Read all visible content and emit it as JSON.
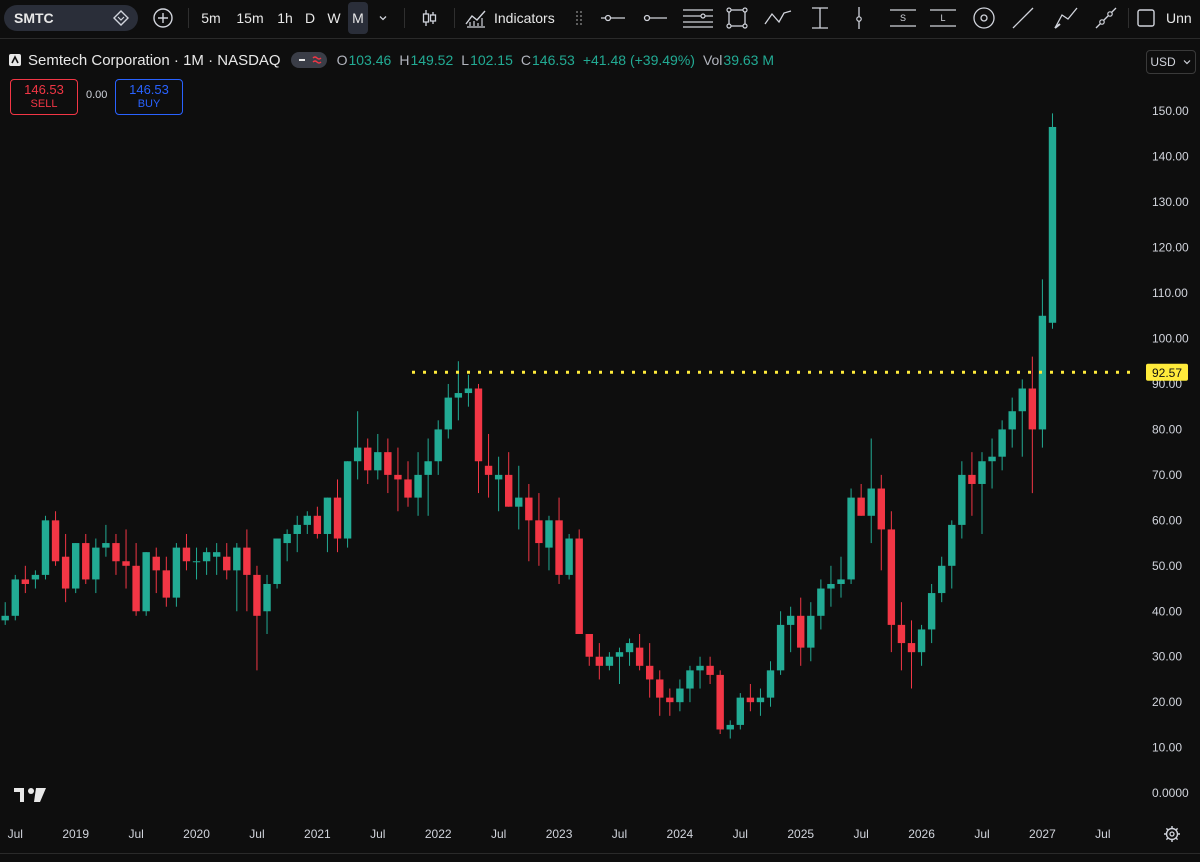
{
  "toolbar": {
    "symbol": "SMTC",
    "timeframes": [
      "5m",
      "15m",
      "1h",
      "D",
      "W",
      "M"
    ],
    "active_timeframe": "M",
    "indicators_label": "Indicators",
    "overflow_label": "Unn"
  },
  "legend": {
    "title": "Semtech Corporation · 1M · NASDAQ",
    "open_label": "O",
    "open": "103.46",
    "high_label": "H",
    "high": "149.52",
    "low_label": "L",
    "low": "102.15",
    "close_label": "C",
    "close": "146.53",
    "change": "+41.48 (+39.49%)",
    "vol_label": "Vol",
    "vol": "39.63 M"
  },
  "trade": {
    "sell_price": "146.53",
    "sell_label": "SELL",
    "spread": "0.00",
    "buy_price": "146.53",
    "buy_label": "BUY"
  },
  "currency": "USD",
  "colors": {
    "up": "#22ab94",
    "down": "#f23645",
    "level_line": "#ffeb3b",
    "background": "#0e0e0e"
  },
  "icons": [
    "alert-diamond-icon",
    "add-compare-icon",
    "chevron-down-icon",
    "candles-icon",
    "indicators-icon",
    "drag-handle-icon",
    "horizontal-ray-icon",
    "horizontal-line-icon",
    "parallel-lines-icon",
    "rectangle-icon",
    "path-icon",
    "vertical-range-icon",
    "vertical-line-icon",
    "s-lines-icon",
    "l-lines-icon",
    "circle-icon",
    "trend-line-icon",
    "brush-icon",
    "trend-segment-icon",
    "layout-icon",
    "tradingview-logo-icon",
    "settings-gear-icon"
  ],
  "chart_data": {
    "type": "candlestick",
    "title": "Semtech Corporation · 1M · NASDAQ",
    "ylim": [
      0,
      155
    ],
    "y_ticks": [
      "150.00",
      "140.00",
      "130.00",
      "120.00",
      "110.00",
      "100.00",
      "90.00",
      "80.00",
      "70.00",
      "60.00",
      "50.00",
      "40.00",
      "30.00",
      "20.00",
      "10.00",
      "0.0000"
    ],
    "x_ticks": [
      "Jul",
      "2019",
      "Jul",
      "2020",
      "Jul",
      "2021",
      "Jul",
      "2022",
      "Jul",
      "2023",
      "Jul",
      "2024",
      "Jul",
      "2025",
      "Jul",
      "2026",
      "Jul",
      "2027",
      "Jul"
    ],
    "horizontal_level": {
      "value": 92.57,
      "label": "92.57",
      "style": "dotted"
    },
    "start": "2018-06",
    "ohlc": [
      [
        38,
        42,
        37,
        39
      ],
      [
        39,
        48,
        38,
        47
      ],
      [
        47,
        50,
        44,
        46
      ],
      [
        47,
        49,
        45,
        48
      ],
      [
        48,
        61,
        47,
        60
      ],
      [
        60,
        62,
        50,
        51
      ],
      [
        52,
        57,
        42,
        45
      ],
      [
        45,
        55,
        44,
        55
      ],
      [
        55,
        57,
        46,
        47
      ],
      [
        47,
        56,
        44,
        54
      ],
      [
        54,
        59,
        52,
        55
      ],
      [
        55,
        57,
        48,
        51
      ],
      [
        51,
        58,
        45,
        50
      ],
      [
        50,
        55,
        39,
        40
      ],
      [
        40,
        53,
        39,
        53
      ],
      [
        52,
        54,
        44,
        49
      ],
      [
        49,
        52,
        41,
        43
      ],
      [
        43,
        55,
        41,
        54
      ],
      [
        54,
        57,
        49,
        51
      ],
      [
        51,
        54,
        47,
        51
      ],
      [
        51,
        54,
        48,
        53
      ],
      [
        52,
        55,
        48,
        53
      ],
      [
        52,
        55,
        47,
        49
      ],
      [
        49,
        55,
        40,
        54
      ],
      [
        54,
        58,
        40,
        48
      ],
      [
        48,
        50,
        27,
        39
      ],
      [
        40,
        48,
        35,
        46
      ],
      [
        46,
        56,
        45,
        56
      ],
      [
        55,
        58,
        51,
        57
      ],
      [
        57,
        61,
        53,
        59
      ],
      [
        59,
        62,
        57,
        61
      ],
      [
        61,
        63,
        56,
        57
      ],
      [
        57,
        65,
        53,
        65
      ],
      [
        65,
        69,
        53,
        56
      ],
      [
        56,
        73,
        54,
        73
      ],
      [
        73,
        84,
        69,
        76
      ],
      [
        76,
        78,
        68,
        71
      ],
      [
        71,
        79,
        69,
        75
      ],
      [
        75,
        78,
        66,
        70
      ],
      [
        70,
        76,
        62,
        69
      ],
      [
        69,
        73,
        63,
        65
      ],
      [
        65,
        75,
        61,
        70
      ],
      [
        70,
        78,
        61,
        73
      ],
      [
        73,
        82,
        70,
        80
      ],
      [
        80,
        90,
        78,
        87
      ],
      [
        87,
        95,
        82,
        88
      ],
      [
        88,
        92,
        85,
        89
      ],
      [
        89,
        90,
        66,
        73
      ],
      [
        72,
        79,
        65,
        70
      ],
      [
        69,
        74,
        62,
        70
      ],
      [
        70,
        75,
        63,
        63
      ],
      [
        63,
        72,
        58,
        65
      ],
      [
        65,
        68,
        51,
        60
      ],
      [
        60,
        66,
        50,
        55
      ],
      [
        54,
        61,
        49,
        60
      ],
      [
        60,
        65,
        46,
        48
      ],
      [
        48,
        57,
        47,
        56
      ],
      [
        56,
        58,
        35,
        35
      ],
      [
        35,
        35,
        28,
        30
      ],
      [
        30,
        33,
        25,
        28
      ],
      [
        28,
        31,
        27,
        30
      ],
      [
        30,
        32,
        24,
        31
      ],
      [
        31,
        34,
        28,
        33
      ],
      [
        32,
        35,
        27,
        28
      ],
      [
        28,
        33,
        21,
        25
      ],
      [
        25,
        27,
        17,
        21
      ],
      [
        21,
        23,
        17,
        20
      ],
      [
        20,
        25,
        18,
        23
      ],
      [
        23,
        28,
        20,
        27
      ],
      [
        27,
        30,
        23,
        28
      ],
      [
        28,
        30,
        24,
        26
      ],
      [
        26,
        27,
        13,
        14
      ],
      [
        14,
        16,
        12,
        15
      ],
      [
        15,
        22,
        14,
        21
      ],
      [
        21,
        24,
        18,
        20
      ],
      [
        20,
        23,
        17,
        21
      ],
      [
        21,
        29,
        19,
        27
      ],
      [
        27,
        40,
        26,
        37
      ],
      [
        37,
        41,
        31,
        39
      ],
      [
        39,
        43,
        28,
        32
      ],
      [
        32,
        42,
        29,
        39
      ],
      [
        39,
        47,
        36,
        45
      ],
      [
        45,
        50,
        41,
        46
      ],
      [
        46,
        52,
        43,
        47
      ],
      [
        47,
        67,
        46,
        65
      ],
      [
        65,
        68,
        61,
        61
      ],
      [
        61,
        78,
        55,
        67
      ],
      [
        67,
        70,
        49,
        58
      ],
      [
        58,
        62,
        31,
        37
      ],
      [
        37,
        42,
        27,
        33
      ],
      [
        33,
        38,
        23,
        31
      ],
      [
        31,
        37,
        28,
        36
      ],
      [
        36,
        46,
        33,
        44
      ],
      [
        44,
        52,
        42,
        50
      ],
      [
        50,
        60,
        45,
        59
      ],
      [
        59,
        73,
        56,
        70
      ],
      [
        70,
        75,
        61,
        68
      ],
      [
        68,
        75,
        57,
        73
      ],
      [
        73,
        78,
        67,
        74
      ],
      [
        74,
        82,
        71,
        80
      ],
      [
        80,
        87,
        76,
        84
      ],
      [
        84,
        91,
        74,
        89
      ],
      [
        89,
        96,
        66,
        80
      ],
      [
        80,
        113,
        76,
        105
      ],
      [
        103.46,
        149.52,
        102.15,
        146.53
      ]
    ]
  }
}
